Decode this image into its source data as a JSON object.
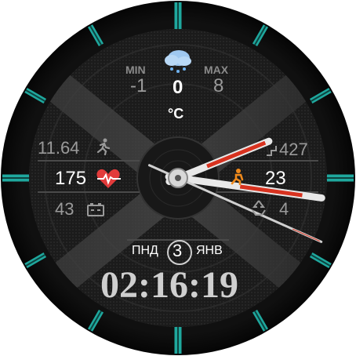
{
  "weather": {
    "min_label": "MIN",
    "max_label": "MAX",
    "min_value": "-1",
    "max_value": "8",
    "current_value": "0",
    "unit": "°C",
    "icon": "snow-cloud-icon"
  },
  "left_panel": {
    "distance": "11.64",
    "distance_icon": "running-person-icon",
    "heart_rate": "175",
    "heart_icon": "heart-pulse-icon",
    "battery": "43",
    "battery_icon": "battery-icon"
  },
  "right_panel": {
    "steps": "427",
    "stairs_icon": "stairs-climber-icon",
    "floors": "23",
    "active_icon": "activity-icon",
    "notifications": "4"
  },
  "date": {
    "weekday": "ПНД",
    "day": "3",
    "month": "ЯНВ"
  },
  "time": {
    "digital": "02:16:19",
    "hour": 2,
    "minute": 16,
    "second": 19
  },
  "colors": {
    "accent_teal": "#1fa89e",
    "hand_red": "#d8321f",
    "heart_red": "#e23b3b",
    "orange_icon": "#f08a1c"
  }
}
